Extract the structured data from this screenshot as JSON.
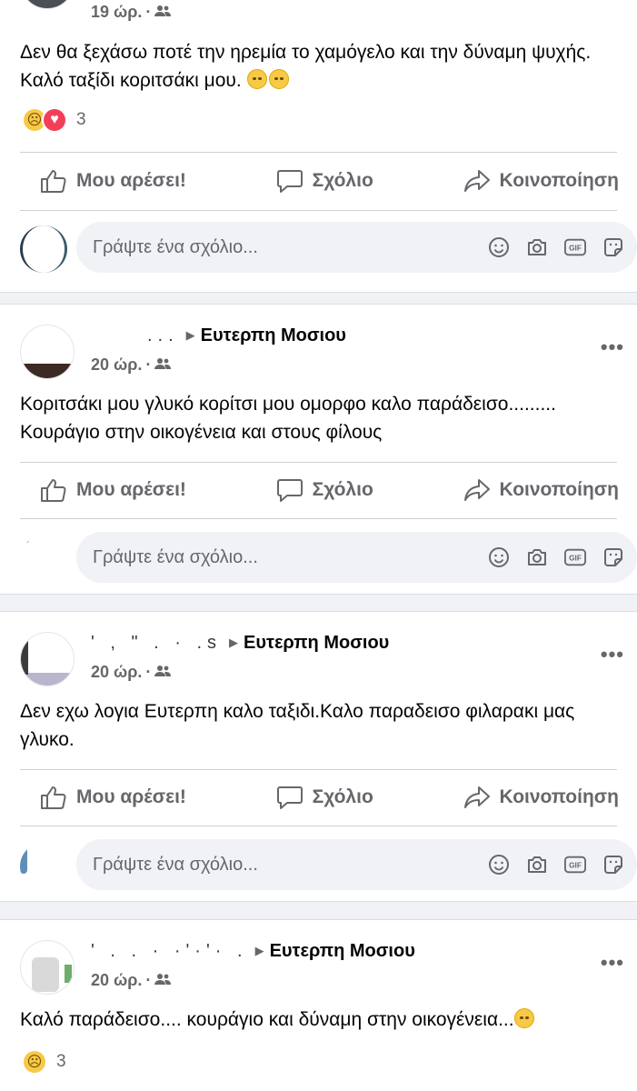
{
  "labels": {
    "like": "Μου αρέσει!",
    "comment": "Σχόλιο",
    "share": "Κοινοποίηση",
    "comment_placeholder": "Γράψτε ένα σχόλιο...",
    "gif": "GIF"
  },
  "icons": [
    "like-icon",
    "comment-icon",
    "share-icon",
    "emoji-icon",
    "camera-icon",
    "gif-icon",
    "sticker-icon",
    "friends-audience-icon",
    "more-options-icon",
    "sad-reaction-icon",
    "love-reaction-icon"
  ],
  "colors": {
    "text_secondary": "#65676b",
    "background": "#f0f2f5",
    "love": "#f33e58",
    "sad": "#f7c948"
  },
  "posts": [
    {
      "author": "",
      "target": "",
      "time": "19 ώρ.",
      "text": "Δεν θα ξεχάσω ποτέ την ηρεμία το χαμόγελο και την δύναμη ψυχής. Καλό ταξίδι κοριτσάκι μου.",
      "reaction_count": "3"
    },
    {
      "author": "...",
      "target": "Ευτερπη Μοσιου",
      "time": "20 ώρ.",
      "text": "Κοριτσάκι μου γλυκό κορίτσι μου ομορφο καλο παράδεισο.........\nΚουράγιο στην οικογένεια και στους φίλους"
    },
    {
      "author": "' ,  \" .   · .s",
      "target": "Ευτερπη Μοσιου",
      "time": "20 ώρ.",
      "text": "Δεν εχω λογια Ευτερπη καλο ταξιδι.Καλο παραδεισο φιλαρακι μας γλυκο."
    },
    {
      "author": "' . .  ·  ·'·'· .",
      "target": "Ευτερπη Μοσιου",
      "time": "20 ώρ.",
      "text": "Καλό παράδεισο.... κουράγιο και δύναμη στην οικογένεια...",
      "reaction_count": "3"
    }
  ]
}
